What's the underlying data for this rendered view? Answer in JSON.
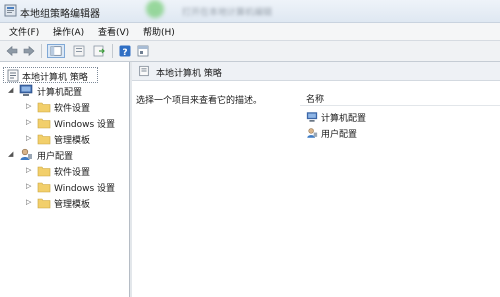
{
  "window": {
    "title": "本地组策略编辑器",
    "blurred_text": "打开在本地计算机编辑"
  },
  "menu": [
    {
      "label": "文件(F)"
    },
    {
      "label": "操作(A)"
    },
    {
      "label": "查看(V)"
    },
    {
      "label": "帮助(H)"
    }
  ],
  "toolbar": {
    "buttons": [
      "back-arrow-icon",
      "forward-arrow-icon",
      "show-hide-tree-icon",
      "properties-icon",
      "export-list-icon",
      "help-icon",
      "view-icon"
    ]
  },
  "tree": {
    "root": "本地计算机 策略",
    "computer": {
      "label": "计算机配置",
      "children": [
        "软件设置",
        "Windows 设置",
        "管理模板"
      ]
    },
    "user": {
      "label": "用户配置",
      "children": [
        "软件设置",
        "Windows 设置",
        "管理模板"
      ]
    }
  },
  "details": {
    "header": "本地计算机 策略",
    "description": "选择一个项目来查看它的描述。",
    "column_name": "名称",
    "items": [
      "计算机配置",
      "用户配置"
    ]
  }
}
